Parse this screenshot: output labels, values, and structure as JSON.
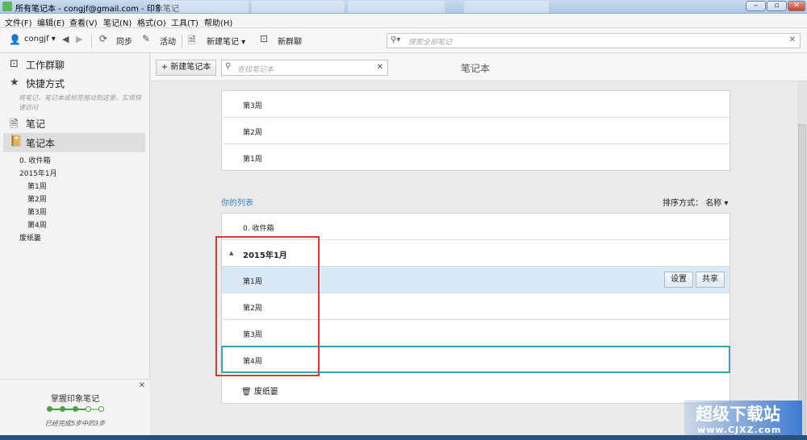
{
  "window": {
    "title": "所有笔记本 - congjf@gmail.com - 印象笔记",
    "minimize": "‒",
    "maximize": "▫",
    "close": "✕"
  },
  "menu": [
    {
      "label": "文件(F)"
    },
    {
      "label": "编辑(E)"
    },
    {
      "label": "查看(V)"
    },
    {
      "label": "笔记(N)"
    },
    {
      "label": "格式(O)"
    },
    {
      "label": "工具(T)"
    },
    {
      "label": "帮助(H)"
    }
  ],
  "toolbar": {
    "user": "congjf",
    "sync": "同步",
    "activity": "活动",
    "new_note": "新建笔记",
    "new_chat": "新群聊",
    "search_placeholder": "搜索全部笔记"
  },
  "sidebar": {
    "work_chat": "工作群聊",
    "shortcuts": "快捷方式",
    "shortcuts_hint": "将笔记、笔记本或标签拖动到这里，实现快速访问",
    "notes": "笔记",
    "notebooks": "笔记本",
    "tree": [
      {
        "label": "0. 收件箱"
      },
      {
        "label": "2015年1月"
      },
      {
        "label": "第1周"
      },
      {
        "label": "第2周"
      },
      {
        "label": "第3周"
      },
      {
        "label": "第4周"
      },
      {
        "label": "废纸篓"
      }
    ],
    "promo": {
      "title": "掌握印象笔记",
      "status": "已经完成5步中的3步",
      "steps_completed": 3,
      "steps_total": 5
    }
  },
  "main": {
    "new_notebook": "新建笔记本",
    "search_placeholder": "查找笔记本",
    "title": "笔记本",
    "recent": [
      {
        "label": "第3周"
      },
      {
        "label": "第2周"
      },
      {
        "label": "第1周"
      }
    ],
    "your_lists": "你的列表",
    "sort_label": "排序方式：",
    "sort_value": "名称",
    "inbox": "0. 收件箱",
    "stack": "2015年1月",
    "weeks": [
      {
        "label": "第1周"
      },
      {
        "label": "第2周"
      },
      {
        "label": "第3周"
      },
      {
        "label": "第4周"
      }
    ],
    "settings": "设置",
    "share": "共享",
    "trash": "废纸篓"
  },
  "watermark": {
    "big": "超级下载站",
    "small": "www.CJXZ.com"
  },
  "colors": {
    "accent_link": "#3d86c6",
    "selected_row": "#d9e9f5",
    "progress_green": "#48a041",
    "annotation_red": "#e03636"
  }
}
